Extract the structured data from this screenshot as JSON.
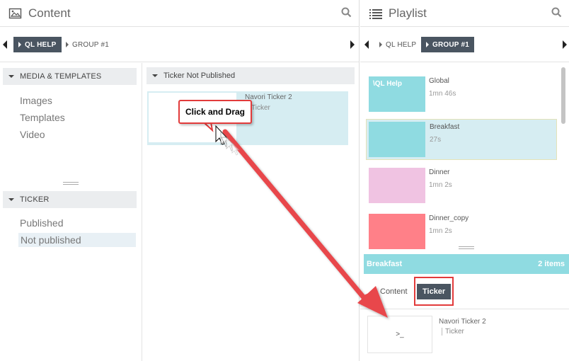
{
  "content_panel": {
    "title": "Content",
    "tabs": [
      {
        "label": "QL HELP",
        "active": true
      },
      {
        "label": "GROUP #1",
        "active": false
      }
    ],
    "media_section": {
      "title": "MEDIA & TEMPLATES",
      "items": [
        "Images",
        "Templates",
        "Video"
      ]
    },
    "ticker_section": {
      "title": "TICKER",
      "items": [
        "Published",
        "Not published"
      ],
      "selected": "Not published"
    },
    "mid": {
      "section_title": "Ticker Not Published",
      "card": {
        "name": "Navori Ticker 2",
        "type": "Ticker"
      }
    }
  },
  "playlist_panel": {
    "title": "Playlist",
    "tabs": [
      {
        "label": "QL HELP",
        "active": false
      },
      {
        "label": "GROUP #1",
        "active": true
      }
    ],
    "items": [
      {
        "name": "Global",
        "duration": "1mn 46s",
        "thumb_label": "\\QL Help",
        "color": "#8fdbe1"
      },
      {
        "name": "Breakfast",
        "duration": "27s",
        "thumb_label": "",
        "color": "#8fdbe1",
        "selected": true
      },
      {
        "name": "Dinner",
        "duration": "1mn 2s",
        "thumb_label": "",
        "color": "#f0c3e2"
      },
      {
        "name": "Dinner_copy",
        "duration": "1mn 2s",
        "thumb_label": "",
        "color": "#ff8088"
      }
    ],
    "selected_bar": {
      "name": "Breakfast",
      "count": "2 items"
    },
    "subtabs": {
      "content_label": "Content",
      "ticker_label": "Ticker"
    },
    "ticker_item": {
      "name": "Navori Ticker 2",
      "type": "Ticker",
      "thumb_text": ">_"
    }
  },
  "annotation": {
    "callout": "Click and Drag",
    "color": "#e23b3b"
  }
}
